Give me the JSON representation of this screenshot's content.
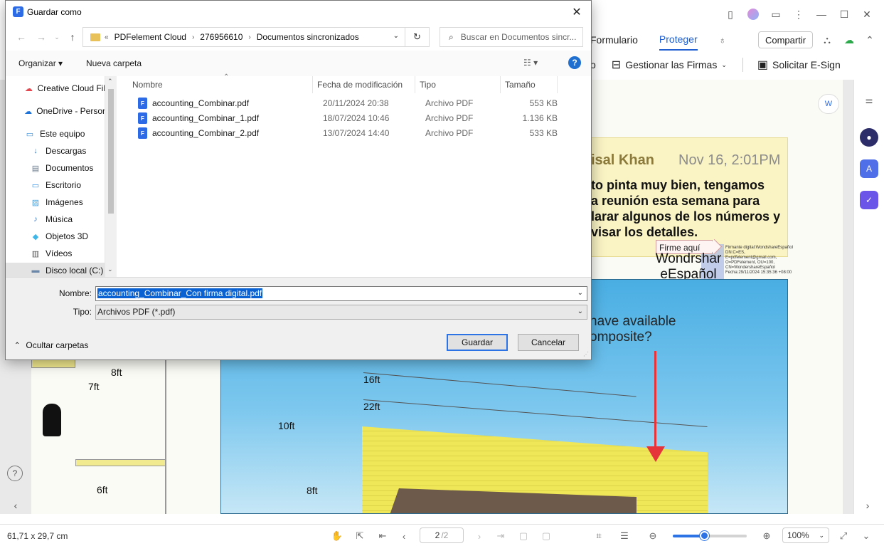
{
  "app": {
    "ribbon_tabs": [
      "Formulario",
      "Proteger"
    ],
    "share_label": "Compartir",
    "tools": {
      "partial_label": "o",
      "manage_signatures": "Gestionar las Firmas",
      "request_esign": "Solicitar E-Sign"
    },
    "comment": {
      "author": "isal Khan",
      "date": "Nov 16, 2:01PM",
      "lines": [
        "to pinta muy bien, tengamos",
        "a reunión esta semana para",
        "larar algunos de los números y",
        "visar los detalles."
      ]
    },
    "signature": {
      "flag_label": "Firme aquí",
      "name_lines": [
        "Wondrshar",
        "eEspañol"
      ],
      "detail": "Firmante digital:WondshareEspañol DN:C=ES, E=pdfelement@gmail.com, O=PDFelement, OU=100, CN=WondershareEspañol Fecha:29/11/2024 15:35:36 +08:00"
    },
    "drawing": {
      "question_lines": [
        "have available",
        "omposite?"
      ],
      "dimensions": [
        "16ft",
        "22ft",
        "10ft",
        "8ft",
        "8ft",
        "7ft",
        "6ft"
      ]
    },
    "statusbar": {
      "page_dims": "61,71 x 29,7 cm",
      "page_current": "2",
      "page_total": "/2",
      "zoom_level": "100%",
      "zoom_fraction": 0.42
    }
  },
  "dialog": {
    "title": "Guardar como",
    "address": {
      "overflow": "«",
      "crumbs": [
        "PDFelement Cloud",
        "276956610",
        "Documentos sincronizados"
      ]
    },
    "search_placeholder": "Buscar en Documentos sincr...",
    "commands": {
      "organize": "Organizar ▾",
      "new_folder": "Nueva carpeta",
      "help": "?"
    },
    "nav_items": [
      {
        "label": "Creative Cloud Fil",
        "icon": "creative-cloud-icon",
        "color": "#e34850"
      },
      {
        "label": "OneDrive - Persor",
        "icon": "onedrive-icon",
        "color": "#1e73d9"
      },
      {
        "label": "Este equipo",
        "icon": "computer-icon",
        "color": "#3a8fd9"
      },
      {
        "label": "Descargas",
        "icon": "download-icon",
        "color": "#2f7bd6"
      },
      {
        "label": "Documentos",
        "icon": "documents-icon",
        "color": "#6b7b8c"
      },
      {
        "label": "Escritorio",
        "icon": "desktop-icon",
        "color": "#2f8fe0"
      },
      {
        "label": "Imágenes",
        "icon": "pictures-icon",
        "color": "#4aa3df"
      },
      {
        "label": "Música",
        "icon": "music-icon",
        "color": "#2f7bd6"
      },
      {
        "label": "Objetos 3D",
        "icon": "3d-objects-icon",
        "color": "#3fb6e8"
      },
      {
        "label": "Vídeos",
        "icon": "videos-icon",
        "color": "#555555"
      },
      {
        "label": "Disco local (C:)",
        "icon": "drive-icon",
        "color": "#6a86a8"
      }
    ],
    "columns": [
      "Nombre",
      "Fecha de modificación",
      "Tipo",
      "Tamaño"
    ],
    "files": [
      {
        "name": "accounting_Combinar.pdf",
        "modified": "20/11/2024 20:38",
        "type": "Archivo PDF",
        "size": "553 KB"
      },
      {
        "name": "accounting_Combinar_1.pdf",
        "modified": "18/07/2024 10:46",
        "type": "Archivo PDF",
        "size": "1.136 KB"
      },
      {
        "name": "accounting_Combinar_2.pdf",
        "modified": "13/07/2024 14:40",
        "type": "Archivo PDF",
        "size": "533 KB"
      }
    ],
    "filename_label": "Nombre:",
    "filename_value": "accounting_Combinar_Con firma digital.pdf",
    "filetype_label": "Tipo:",
    "filetype_value": "Archivos PDF (*.pdf)",
    "hide_folders": "Ocultar carpetas",
    "save_label": "Guardar",
    "cancel_label": "Cancelar"
  }
}
